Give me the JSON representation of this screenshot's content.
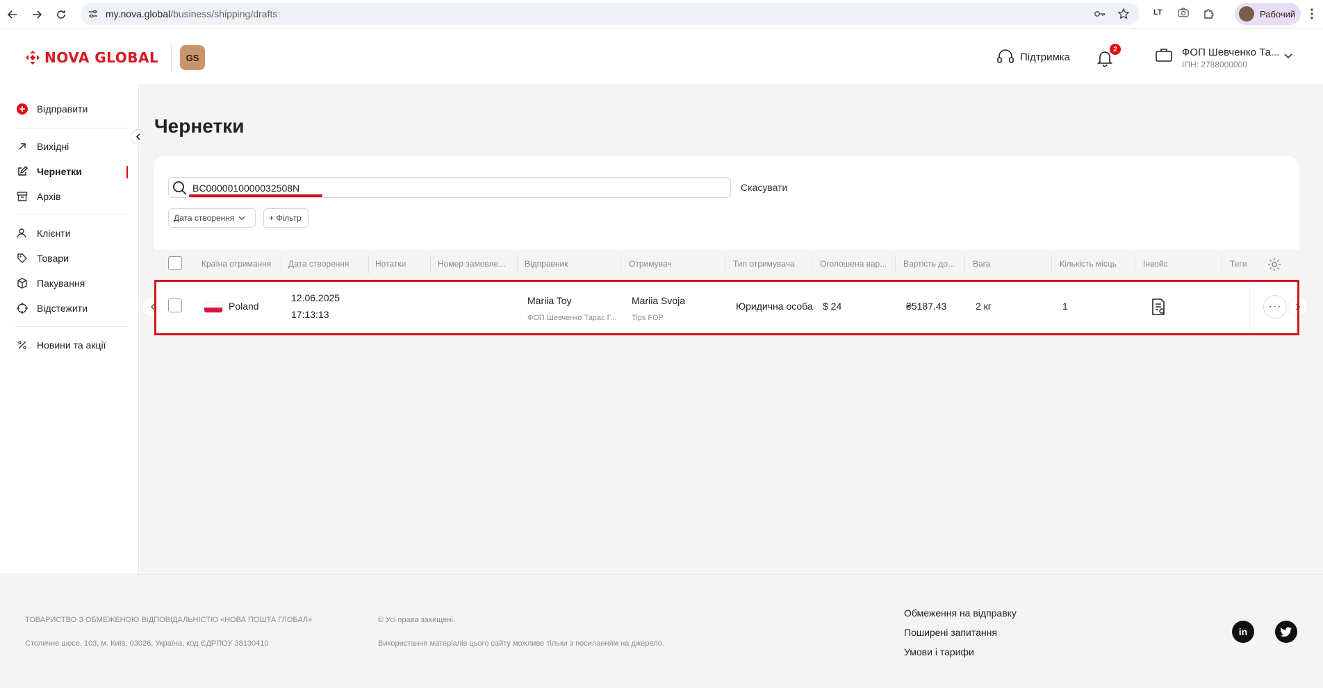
{
  "browser": {
    "url_host": "my.nova.global",
    "url_path": "/business/shipping/drafts",
    "ext_label": "LT",
    "profile_name": "Рабочий"
  },
  "header": {
    "logo_text": "NOVA GLOBAL",
    "badge_text": "GS",
    "support_label": "Підтримка",
    "notifications_count": "2",
    "account_name": "ФОП Шевченко Та...",
    "account_ipn": "ІПН: 2788000000"
  },
  "sidebar": {
    "send_label": "Відправити",
    "items": [
      {
        "label": "Вихідні"
      },
      {
        "label": "Чернетки"
      },
      {
        "label": "Архів"
      },
      {
        "label": "Клієнти"
      },
      {
        "label": "Товари"
      },
      {
        "label": "Пакування"
      },
      {
        "label": "Відстежити"
      },
      {
        "label": "Новини та акції"
      }
    ]
  },
  "page": {
    "title": "Чернетки",
    "search_value": "BC0000010000032508N",
    "cancel_label": "Скасувати",
    "filter_date_label": "Дата створення",
    "filter_add_label": "+ Фільтр"
  },
  "table": {
    "columns": [
      "Країна отримання",
      "Дата створення",
      "Нотатки",
      "Номер замовле...",
      "Відправник",
      "Отримувач",
      "Тип отримувача",
      "Оголошена вар...",
      "Вартість до...",
      "Вага",
      "Кількість місць",
      "Інвойс",
      "Теги"
    ],
    "row": {
      "country": "Poland",
      "date": "12.06.2025",
      "time": "17:13:13",
      "sender_name": "Mariia Toy",
      "sender_company": "ФОП Шевченко Тарас Г...",
      "recipient_name": "Mariia Svoja",
      "recipient_company": "Tips FOP",
      "recipient_type": "Юридична особа",
      "declared_value": "$ 24",
      "delivery_cost": "₴5187.43",
      "weight": "2 кг",
      "places": "1",
      "more": "···"
    }
  },
  "footer": {
    "company": "ТОВАРИСТВО З ОБМЕЖЕНОЮ ВІДПОВІДАЛЬНІСТЮ «НОВА ПОШТА ГЛОБАЛ»",
    "address": "Столичне шосе, 103, м. Київ, 03026, Україна, код ЄДРПОУ 38130410",
    "rights": "© Усі права захищені.",
    "usage": "Використання матеріалів цього сайту можливе тільки з посиланням на джерело.",
    "links": [
      "Обмеження на відправку",
      "Поширені запитання",
      "Умови і тарифи"
    ],
    "linkedin": "in"
  },
  "colors": {
    "brand_red": "#d71921",
    "highlight_red": "#d4121a",
    "background": "#f4f4f5"
  },
  "icons": [
    "back-icon",
    "forward-icon",
    "reload-icon",
    "tune-icon",
    "key-icon",
    "star-icon",
    "camera-icon",
    "puzzle-icon",
    "menu-dots-icon",
    "headset-icon",
    "bell-icon",
    "briefcase-icon",
    "chevron-down-icon",
    "plus-circle-icon",
    "arrow-up-right-icon",
    "edit-icon",
    "archive-icon",
    "users-icon",
    "tag-icon",
    "box-icon",
    "target-icon",
    "percent-icon",
    "search-icon",
    "gear-icon",
    "invoice-icon",
    "linkedin-icon",
    "twitter-icon"
  ]
}
